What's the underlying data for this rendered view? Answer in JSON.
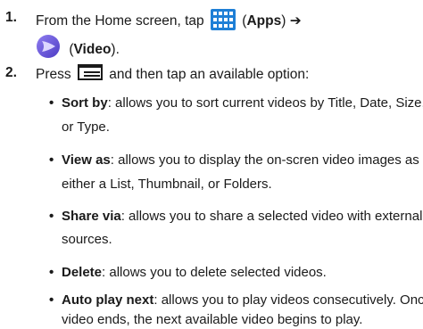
{
  "steps": [
    {
      "number": "1.",
      "line1_pre": "From the Home screen, tap",
      "apps_paren_open": "(",
      "apps_label": "Apps",
      "apps_paren_close": ")",
      "arrow": "➔",
      "video_paren_open": "(",
      "video_label": "Video",
      "video_paren_close": ").",
      "apps_icon": "apps-grid-icon",
      "video_icon": "video-app-icon"
    },
    {
      "number": "2.",
      "text_pre": "Press",
      "text_post": "and then tap an available option:",
      "menu_icon": "menu-key-icon"
    }
  ],
  "options": [
    {
      "term": "Sort by",
      "desc": ": allows you to sort current videos by Title, Date, Size,",
      "cont": "or Type."
    },
    {
      "term": "View as",
      "desc": ": allows you to display the on-scren video images as",
      "cont": "either a List, Thumbnail, or Folders."
    },
    {
      "term": "Share via",
      "desc": ": allows you to share a selected video with external",
      "cont": "sources."
    },
    {
      "term": "Delete",
      "desc": ": allows you to delete selected videos.",
      "cont": ""
    },
    {
      "term": "Auto play next",
      "desc": ": allows you to play videos consecutively. Once a",
      "cont": "video ends, the next available video begins to play."
    }
  ],
  "colors": {
    "apps_icon": "#1e7fd6",
    "video_icon": "#6a5bd8",
    "text": "#1a1a1a"
  }
}
